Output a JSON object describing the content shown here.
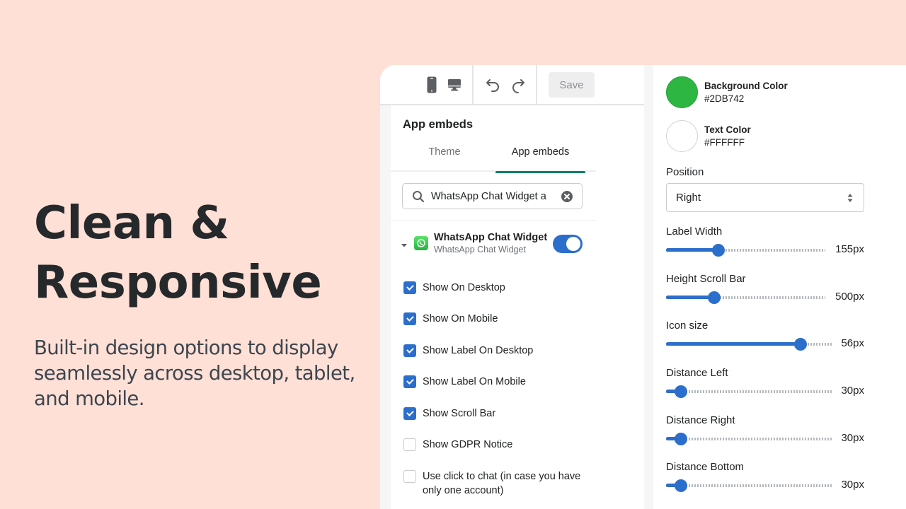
{
  "hero": {
    "title_line1": "Clean &",
    "title_line2": "Responsive",
    "subtitle": "Built-in design options to display seamlessly across desktop, tablet, and mobile."
  },
  "toolbar": {
    "icons": [
      "mobile-icon",
      "desktop-icon",
      "undo-icon",
      "redo-icon"
    ],
    "save_label": "Save"
  },
  "left_panel": {
    "section_title": "App embeds",
    "tabs": [
      {
        "label": "Theme",
        "active": false
      },
      {
        "label": "App embeds",
        "active": true
      }
    ],
    "search": {
      "value": "WhatsApp Chat Widget a",
      "placeholder": ""
    },
    "app": {
      "name": "WhatsApp Chat Widget",
      "subtitle": "WhatsApp Chat Widget",
      "enabled": true
    },
    "options": [
      {
        "label": "Show On Desktop",
        "checked": true
      },
      {
        "label": "Show On Mobile",
        "checked": true
      },
      {
        "label": "Show Label On Desktop",
        "checked": true
      },
      {
        "label": "Show Label On Mobile",
        "checked": true
      },
      {
        "label": "Show Scroll Bar",
        "checked": true
      },
      {
        "label": "Show GDPR Notice",
        "checked": false
      },
      {
        "label": "Use click to chat (in case you have only one account)",
        "checked": false
      }
    ]
  },
  "right_panel": {
    "colors": [
      {
        "title": "Background Color",
        "hex": "#2DB742"
      },
      {
        "title": "Text Color",
        "hex": "#FFFFFF"
      }
    ],
    "position": {
      "label": "Position",
      "value": "Right"
    },
    "sliders": [
      {
        "label": "Label Width",
        "value_text": "155px",
        "fraction": 0.33
      },
      {
        "label": "Height Scroll Bar",
        "value_text": "500px",
        "fraction": 0.3
      },
      {
        "label": "Icon size",
        "value_text": "56px",
        "fraction": 0.81
      },
      {
        "label": "Distance Left",
        "value_text": "30px",
        "fraction": 0.09
      },
      {
        "label": "Distance Right",
        "value_text": "30px",
        "fraction": 0.09
      },
      {
        "label": "Distance Bottom",
        "value_text": "30px",
        "fraction": 0.09
      }
    ]
  },
  "theme_colors": {
    "background": "#FFE0D6",
    "accent_blue": "#2C6ECB",
    "tab_underline": "#008060"
  }
}
